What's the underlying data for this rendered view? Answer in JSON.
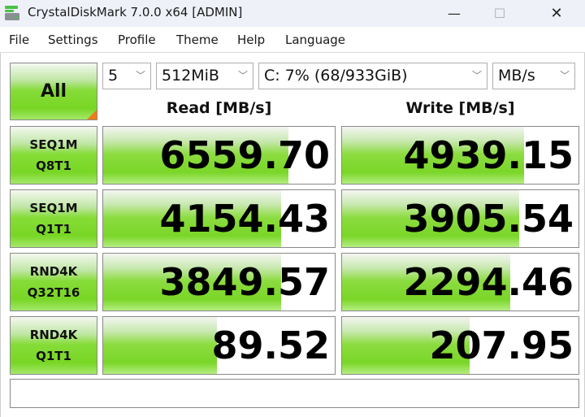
{
  "window": {
    "title": "CrystalDiskMark 7.0.0 x64 [ADMIN]",
    "icon": "disk-app-icon",
    "controls": {
      "minimize": "—",
      "maximize": "☐",
      "close": "✕"
    }
  },
  "menu": {
    "items": [
      "File",
      "Settings",
      "Profile",
      "Theme",
      "Help",
      "Language"
    ]
  },
  "toolbar": {
    "all_button": "All",
    "count_select": "5",
    "size_select": "512MiB",
    "drive_select": "C: 7% (68/933GiB)",
    "unit_select": "MB/s"
  },
  "columns": {
    "read": "Read [MB/s]",
    "write": "Write [MB/s]"
  },
  "tests": [
    {
      "line1": "SEQ1M",
      "line2": "Q8T1",
      "read": "6559.70",
      "write": "4939.15",
      "read_fill": 0.8,
      "write_fill": 0.77
    },
    {
      "line1": "SEQ1M",
      "line2": "Q1T1",
      "read": "4154.43",
      "write": "3905.54",
      "read_fill": 0.77,
      "write_fill": 0.75
    },
    {
      "line1": "RND4K",
      "line2": "Q32T16",
      "read": "3849.57",
      "write": "2294.46",
      "read_fill": 0.77,
      "write_fill": 0.71
    },
    {
      "line1": "RND4K",
      "line2": "Q1T1",
      "read": "89.52",
      "write": "207.95",
      "read_fill": 0.49,
      "write_fill": 0.54
    }
  ],
  "comment": "",
  "colors": {
    "accent_green": "#7ad628",
    "corner_orange": "#f07a1a"
  }
}
